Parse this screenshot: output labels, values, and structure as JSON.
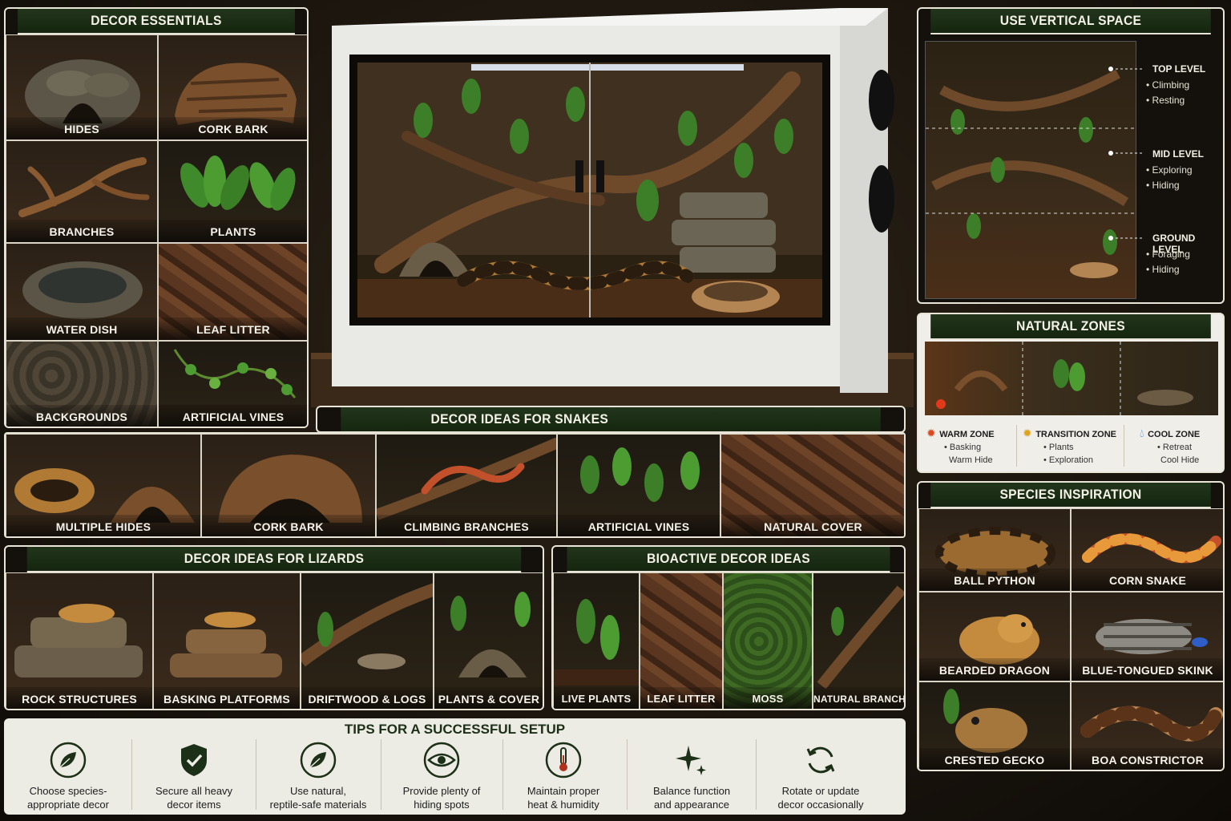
{
  "decor_essentials": {
    "title": "DECOR ESSENTIALS",
    "items": [
      {
        "label": "HIDES",
        "icon": "rock-hide-icon"
      },
      {
        "label": "CORK BARK",
        "icon": "cork-bark-icon"
      },
      {
        "label": "BRANCHES",
        "icon": "branch-icon"
      },
      {
        "label": "PLANTS",
        "icon": "plant-icon"
      },
      {
        "label": "WATER DISH",
        "icon": "water-dish-icon"
      },
      {
        "label": "LEAF LITTER",
        "icon": "leaf-litter-icon"
      },
      {
        "label": "BACKGROUNDS",
        "icon": "background-icon"
      },
      {
        "label": "ARTIFICIAL VINES",
        "icon": "vine-icon"
      }
    ]
  },
  "vertical_space": {
    "title": "USE VERTICAL SPACE",
    "levels": [
      {
        "name": "TOP LEVEL",
        "uses": [
          "Climbing",
          "Resting"
        ]
      },
      {
        "name": "MID LEVEL",
        "uses": [
          "Exploring",
          "Hiding"
        ]
      },
      {
        "name": "GROUND LEVEL",
        "uses": [
          "Foraging",
          "Hiding"
        ]
      }
    ]
  },
  "natural_zones": {
    "title": "NATURAL ZONES",
    "zones": [
      {
        "name": "WARM ZONE",
        "items": [
          "Basking",
          "Warm Hide"
        ],
        "color": "#d84a1f"
      },
      {
        "name": "TRANSITION ZONE",
        "items": [
          "Plants",
          "Exploration"
        ],
        "color": "#e0a21a"
      },
      {
        "name": "COOL ZONE",
        "items": [
          "Retreat",
          "Cool Hide"
        ],
        "color": "#2b86d6"
      }
    ]
  },
  "snakes": {
    "title": "DECOR IDEAS FOR SNAKES",
    "items": [
      "MULTIPLE HIDES",
      "CORK BARK",
      "CLIMBING BRANCHES",
      "ARTIFICIAL VINES",
      "NATURAL COVER"
    ]
  },
  "lizards": {
    "title": "DECOR IDEAS FOR LIZARDS",
    "items": [
      "ROCK STRUCTURES",
      "BASKING PLATFORMS",
      "DRIFTWOOD & LOGS",
      "PLANTS & COVER"
    ]
  },
  "bioactive": {
    "title": "BIOACTIVE DECOR IDEAS",
    "items": [
      "LIVE PLANTS",
      "LEAF LITTER",
      "MOSS",
      "NATURAL BRANCHES"
    ]
  },
  "species": {
    "title": "SPECIES INSPIRATION",
    "items": [
      "BALL PYTHON",
      "CORN SNAKE",
      "BEARDED DRAGON",
      "BLUE-TONGUED SKINK",
      "CRESTED GECKO",
      "BOA CONSTRICTOR"
    ]
  },
  "tips": {
    "title": "TIPS FOR A SUCCESSFUL SETUP",
    "items": [
      {
        "line1": "Choose species-",
        "line2": "appropriate decor",
        "icon": "leaf-icon"
      },
      {
        "line1": "Secure all heavy",
        "line2": "decor items",
        "icon": "shield-check-icon"
      },
      {
        "line1": "Use natural,",
        "line2": "reptile-safe materials",
        "icon": "leaf-icon"
      },
      {
        "line1": "Provide plenty of",
        "line2": "hiding spots",
        "icon": "eye-icon"
      },
      {
        "line1": "Maintain proper",
        "line2": "heat & humidity",
        "icon": "thermometer-icon"
      },
      {
        "line1": "Balance function",
        "line2": "and appearance",
        "icon": "sparkle-icon"
      },
      {
        "line1": "Rotate or update",
        "line2": "decor occasionally",
        "icon": "refresh-icon"
      }
    ]
  },
  "colors": {
    "header_green": "#1c2f17",
    "border": "#e8e4d8",
    "tips_bg": "#ecebe4"
  }
}
